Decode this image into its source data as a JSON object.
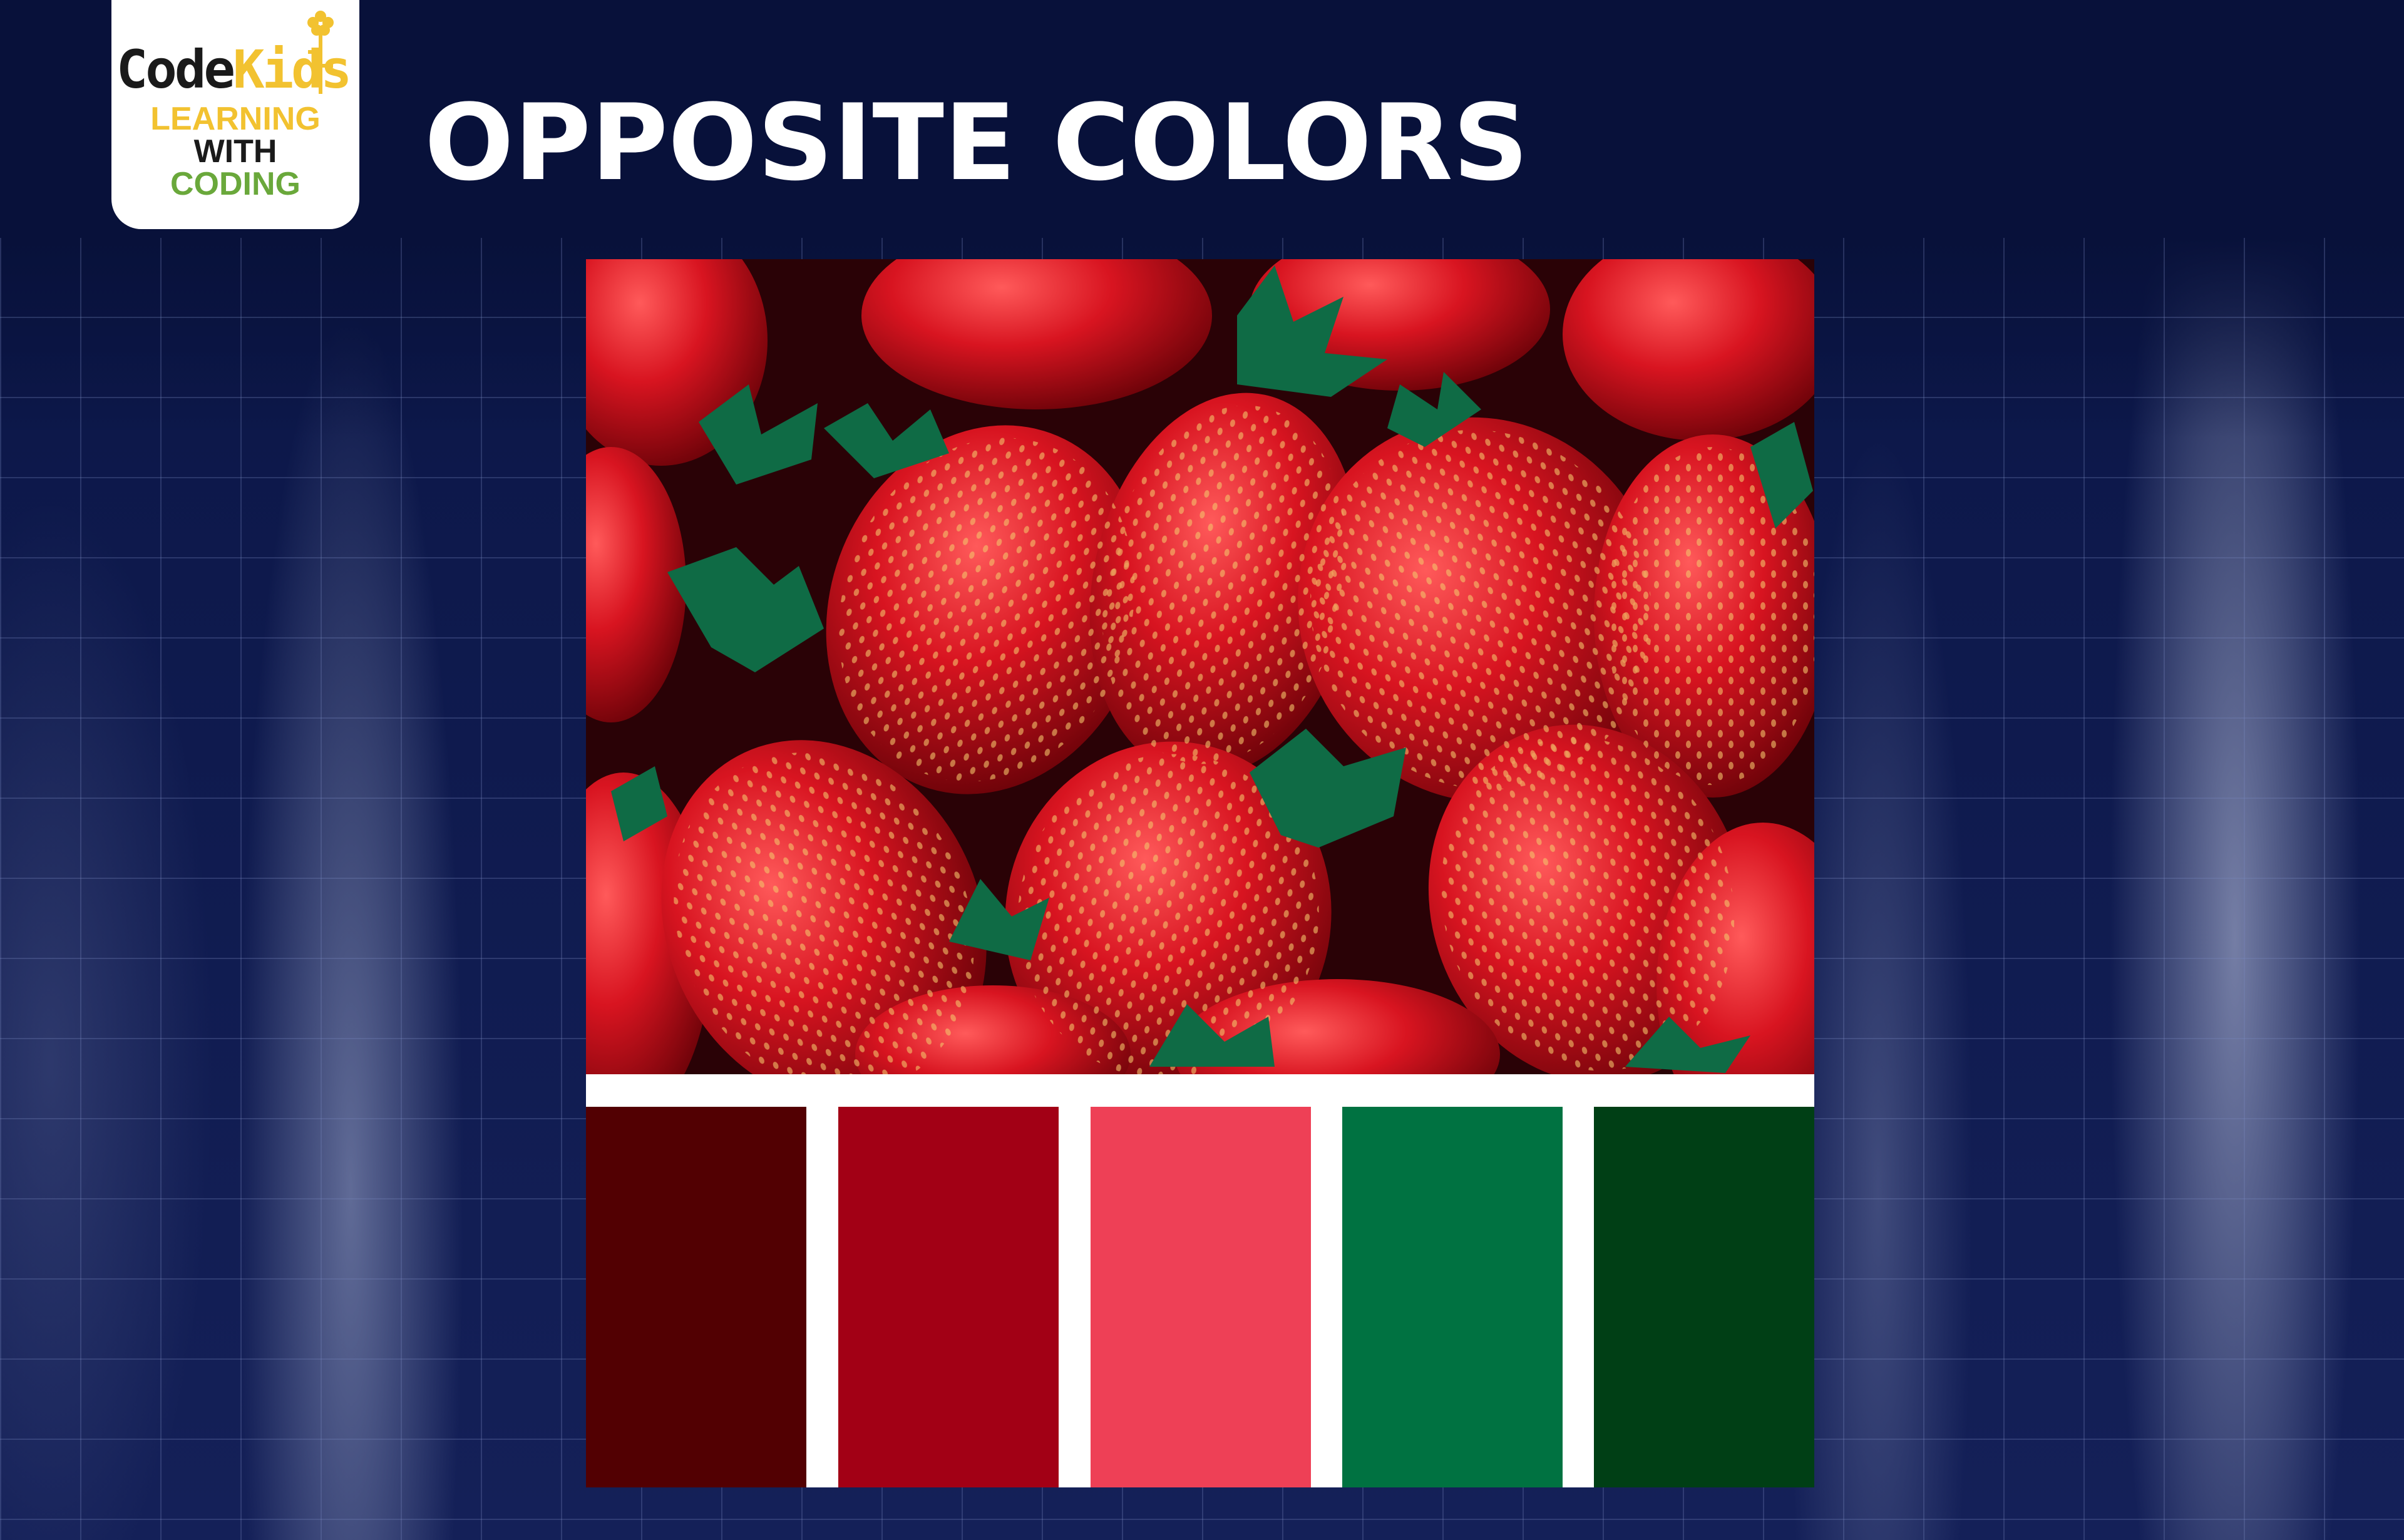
{
  "logo": {
    "code_part1": "Code",
    "code_part2": "Kids",
    "line1": "LEARNING",
    "line2": "WITH",
    "line3": "CODING"
  },
  "title": "OPPOSITE COLORS",
  "image": {
    "subject": "strawberries-photo"
  },
  "palette": [
    {
      "color": "#520002"
    },
    {
      "color": "#a20015"
    },
    {
      "color": "#ee4056"
    },
    {
      "color": "#007241"
    },
    {
      "color": "#003f15"
    }
  ],
  "colors": {
    "background": "#08113a",
    "title": "#ffffff",
    "logo_yellow": "#f2c230",
    "logo_green": "#6aa83b"
  }
}
